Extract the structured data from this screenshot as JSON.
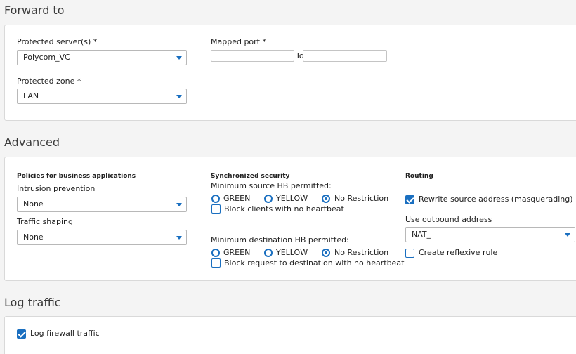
{
  "forward": {
    "title": "Forward to",
    "protected_servers_label": "Protected server(s) *",
    "protected_servers_value": "Polycom_VC",
    "protected_zone_label": "Protected zone *",
    "protected_zone_value": "LAN",
    "mapped_port_label": "Mapped port *",
    "mapped_port_from": "",
    "to_label": "To",
    "mapped_port_to": ""
  },
  "advanced": {
    "title": "Advanced",
    "policies_heading": "Policies for business applications",
    "intrusion_label": "Intrusion prevention",
    "intrusion_value": "None",
    "traffic_label": "Traffic shaping",
    "traffic_value": "None",
    "sync_heading": "Synchronized security",
    "min_source_label": "Minimum source HB permitted:",
    "min_dest_label": "Minimum destination HB permitted:",
    "hb_options": [
      "GREEN",
      "YELLOW",
      "No Restriction"
    ],
    "source_selected": "No Restriction",
    "dest_selected": "No Restriction",
    "block_clients_label": "Block clients with no heartbeat",
    "block_clients_checked": false,
    "block_request_label": "Block request to destination with no heartbeat",
    "block_request_checked": false,
    "routing_heading": "Routing",
    "rewrite_label": "Rewrite source address (masquerading)",
    "rewrite_checked": true,
    "outbound_label": "Use outbound address",
    "outbound_value": "NAT_",
    "reflexive_label": "Create reflexive rule",
    "reflexive_checked": false
  },
  "log": {
    "title": "Log traffic",
    "log_firewall_label": "Log firewall traffic",
    "log_firewall_checked": true
  },
  "colors": {
    "accent": "#1a6fc0",
    "panel_bg": "#ffffff",
    "page_bg": "#f4f4f4"
  }
}
